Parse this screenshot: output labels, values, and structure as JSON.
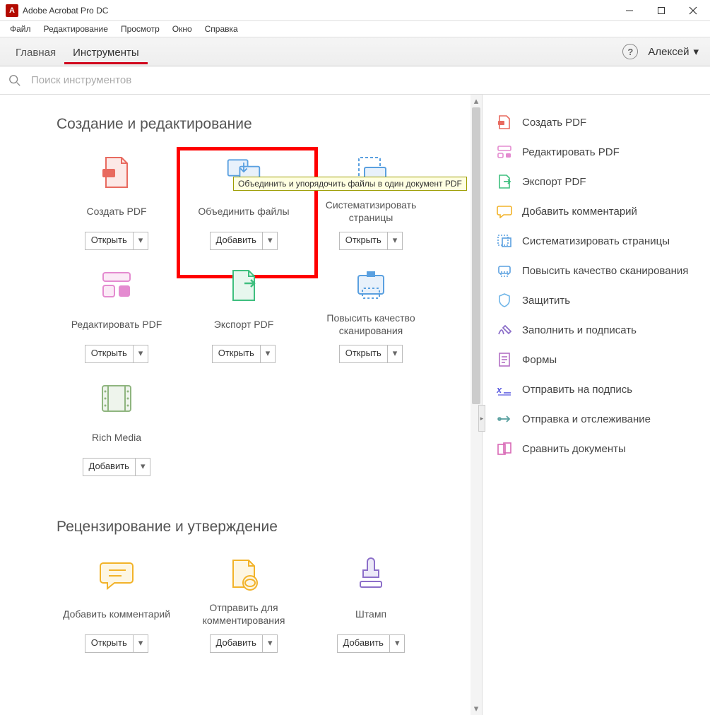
{
  "app": {
    "title": "Adobe Acrobat Pro DC"
  },
  "menu": {
    "file": "Файл",
    "edit": "Редактирование",
    "view": "Просмотр",
    "window": "Окно",
    "help": "Справка"
  },
  "tabs": {
    "home": "Главная",
    "tools": "Инструменты"
  },
  "user": {
    "name": "Алексей"
  },
  "search": {
    "placeholder": "Поиск инструментов"
  },
  "sections": {
    "create_edit": "Создание и редактирование",
    "review_approve": "Рецензирование и утверждение"
  },
  "tools": {
    "create_pdf": {
      "label": "Создать PDF",
      "action": "Открыть"
    },
    "combine_files": {
      "label": "Объединить файлы",
      "action": "Добавить",
      "tooltip": "Объединить и упорядочить файлы в один документ PDF"
    },
    "organize_pages": {
      "label": "Систематизировать страницы",
      "action": "Открыть"
    },
    "edit_pdf": {
      "label": "Редактировать PDF",
      "action": "Открыть"
    },
    "export_pdf": {
      "label": "Экспорт PDF",
      "action": "Открыть"
    },
    "enhance_scans": {
      "label": "Повысить качество сканирования",
      "action": "Открыть"
    },
    "rich_media": {
      "label": "Rich Media",
      "action": "Добавить"
    },
    "add_comment": {
      "label": "Добавить комментарий",
      "action": "Открыть"
    },
    "send_for_comments": {
      "label": "Отправить для комментирования",
      "action": "Добавить"
    },
    "stamp": {
      "label": "Штамп",
      "action": "Добавить"
    }
  },
  "sidebar": {
    "items": [
      {
        "label": "Создать PDF",
        "icon": "create",
        "color": "#e86a5f"
      },
      {
        "label": "Редактировать PDF",
        "icon": "edit",
        "color": "#e48bd0"
      },
      {
        "label": "Экспорт PDF",
        "icon": "export",
        "color": "#3fbf7f"
      },
      {
        "label": "Добавить комментарий",
        "icon": "comment",
        "color": "#f2b32a"
      },
      {
        "label": "Систематизировать страницы",
        "icon": "organize",
        "color": "#5aa0e0"
      },
      {
        "label": "Повысить качество сканирования",
        "icon": "scan",
        "color": "#5aa0e0"
      },
      {
        "label": "Защитить",
        "icon": "protect",
        "color": "#6fb5e8"
      },
      {
        "label": "Заполнить и подписать",
        "icon": "sign",
        "color": "#8c6fc9"
      },
      {
        "label": "Формы",
        "icon": "forms",
        "color": "#b26fc5"
      },
      {
        "label": "Отправить на подпись",
        "icon": "send-sign",
        "color": "#5a5ae0"
      },
      {
        "label": "Отправка и отслеживание",
        "icon": "track",
        "color": "#5aa0a0"
      },
      {
        "label": "Сравнить документы",
        "icon": "compare",
        "color": "#d968b5"
      }
    ]
  }
}
